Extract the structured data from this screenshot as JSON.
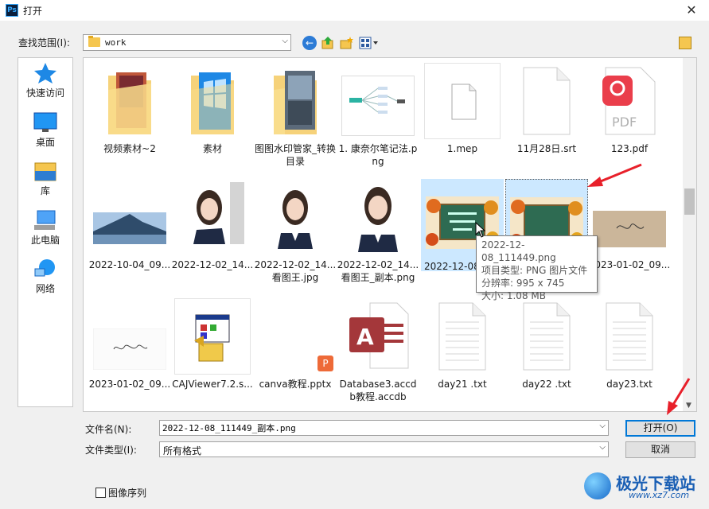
{
  "window": {
    "title": "打开",
    "app_icon": "Ps"
  },
  "toolbar": {
    "lookin_label": "查找范围(I):",
    "lookin_value": "work"
  },
  "places": [
    {
      "label": "快速访问",
      "icon": "star-icon"
    },
    {
      "label": "桌面",
      "icon": "desktop-icon"
    },
    {
      "label": "库",
      "icon": "library-icon"
    },
    {
      "label": "此电脑",
      "icon": "computer-icon"
    },
    {
      "label": "网络",
      "icon": "network-icon"
    }
  ],
  "files": [
    {
      "label": "视频素材~2",
      "type": "folder"
    },
    {
      "label": "素材",
      "type": "folder"
    },
    {
      "label": "图图水印管家_转换目录",
      "type": "folder"
    },
    {
      "label": "1. 康奈尔笔记法.png",
      "type": "image"
    },
    {
      "label": "1.mep",
      "type": "file"
    },
    {
      "label": "11月28日.srt",
      "type": "file"
    },
    {
      "label": "123.pdf",
      "type": "pdf"
    },
    {
      "label": "2022-10-04_09...",
      "type": "image"
    },
    {
      "label": "2022-12-02_14...",
      "type": "image"
    },
    {
      "label": "2022-12-02_14...看图王.jpg",
      "type": "image"
    },
    {
      "label": "2022-12-02_14...看图王_副本.png",
      "type": "image"
    },
    {
      "label": "2022-12-08_",
      "type": "image"
    },
    {
      "label": "",
      "type": "image"
    },
    {
      "label": "2023-01-02_09...",
      "type": "image"
    },
    {
      "label": "2023-01-02_09...",
      "type": "image"
    },
    {
      "label": "CAJViewer7.2.s...",
      "type": "exe"
    },
    {
      "label": "canva教程.pptx",
      "type": "pptx"
    },
    {
      "label": "Database3.accdb教程.accdb",
      "type": "accdb"
    },
    {
      "label": "day21 .txt",
      "type": "txt"
    },
    {
      "label": "day22 .txt",
      "type": "txt"
    },
    {
      "label": "day23.txt",
      "type": "txt"
    }
  ],
  "tooltip": {
    "line1": "2022-12-08_111449.png",
    "line2": "项目类型: PNG 图片文件",
    "line3": "分辨率: 995 x 745",
    "line4": "大小: 1.08 MB"
  },
  "form": {
    "filename_label": "文件名(N):",
    "filename_value": "2022-12-08_111449_副本.png",
    "filetype_label": "文件类型(I):",
    "filetype_value": "所有格式",
    "open_label": "打开(O)",
    "cancel_label": "取消",
    "sequence_label": "图像序列"
  },
  "watermark": {
    "name": "极光下载站",
    "url": "www.xz7.com"
  },
  "colors": {
    "accent": "#0078d7",
    "selection": "#cce8ff",
    "arrow": "#e8202a"
  }
}
